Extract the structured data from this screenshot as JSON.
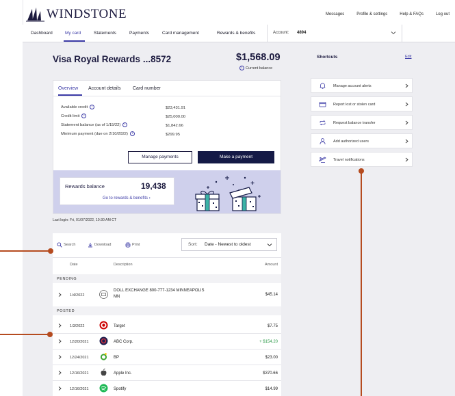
{
  "brand": {
    "name": "WINDSTONE",
    "color": "#1c1a3f",
    "accent": "#3b3aa6",
    "primary_button": "#151a46"
  },
  "utility_nav": [
    "Messages",
    "Profile & settings",
    "Help & FAQs",
    "Log out"
  ],
  "main_nav": {
    "items": [
      "Dashboard",
      "My card",
      "Statements",
      "Payments",
      "Card management",
      "Rewards & benefits"
    ],
    "active": "My card",
    "account_label": "Account:",
    "account_value": "4894"
  },
  "card": {
    "title": "Visa Royal Rewards ...8572",
    "balance": "$1,568.09",
    "balance_label": "Current balance"
  },
  "overview": {
    "tabs": [
      "Overview",
      "Account details",
      "Card number"
    ],
    "active_tab": "Overview",
    "rows": [
      {
        "label": "Available credit",
        "value": "$23,431.91",
        "info": true
      },
      {
        "label": "Credit limit",
        "value": "$25,000.00",
        "info": true
      },
      {
        "label": "Statement balance (as of 1/15/22)",
        "value": "$1,842.66",
        "info": true
      },
      {
        "label": "Minimum payment (due on 2/10/2022)",
        "value": "$299.95",
        "info": true
      }
    ],
    "manage_payments": "Manage payments",
    "make_payment": "Make a payment"
  },
  "rewards": {
    "label": "Rewards balance",
    "value": "19,438",
    "link": "Go to rewards & benefits"
  },
  "last_login": "Last login: Fri, 01/07/2022, 10:30 AM CT",
  "transactions": {
    "tools": {
      "search": "Search",
      "download": "Download",
      "print": "Print"
    },
    "sort_label": "Sort:",
    "sort_value": "Date - Newest to oldest",
    "columns": {
      "date": "Date",
      "description": "Description",
      "amount": "Amount"
    },
    "pending_label": "PENDING",
    "posted_label": "POSTED",
    "pending": [
      {
        "date": "1/4/2022",
        "desc1": "DOLL EXCHANGE 800-777-1234 MINNEAPOLIS",
        "desc2": "MN",
        "amount": "$45.14",
        "icon": "merchant-generic-icon",
        "icon_color": "#ffffff"
      }
    ],
    "posted": [
      {
        "date": "1/3/2022",
        "desc": "Target",
        "amount": "$7.75",
        "icon": "target-logo-icon",
        "icon_color": "#cc0000",
        "credit": false
      },
      {
        "date": "12/20/2021",
        "desc": "ABC Corp.",
        "amount": "+ $154.20",
        "icon": "abc-logo-icon",
        "icon_color": "#1d1f4f",
        "credit": true
      },
      {
        "date": "12/24/2021",
        "desc": "BP",
        "amount": "$23.00",
        "icon": "bp-logo-icon",
        "icon_color": "#3fa535",
        "credit": false
      },
      {
        "date": "12/16/2021",
        "desc": "Apple Inc.",
        "amount": "$370.66",
        "icon": "apple-logo-icon",
        "icon_color": "#444444",
        "credit": false
      },
      {
        "date": "12/16/2021",
        "desc": "Spotify",
        "amount": "$14.99",
        "icon": "spotify-logo-icon",
        "icon_color": "#1db954",
        "credit": false
      }
    ]
  },
  "shortcuts": {
    "title": "Shortcuts",
    "edit": "Edit",
    "items": [
      {
        "label": "Manage account alerts",
        "icon": "bell-icon"
      },
      {
        "label": "Report lost or stolen card",
        "icon": "card-icon"
      },
      {
        "label": "Request balance transfer",
        "icon": "transfer-icon"
      },
      {
        "label": "Add authorized users",
        "icon": "user-icon"
      },
      {
        "label": "Travel notifications",
        "icon": "plane-icon"
      }
    ]
  },
  "annotation_color": "#b54b1f"
}
